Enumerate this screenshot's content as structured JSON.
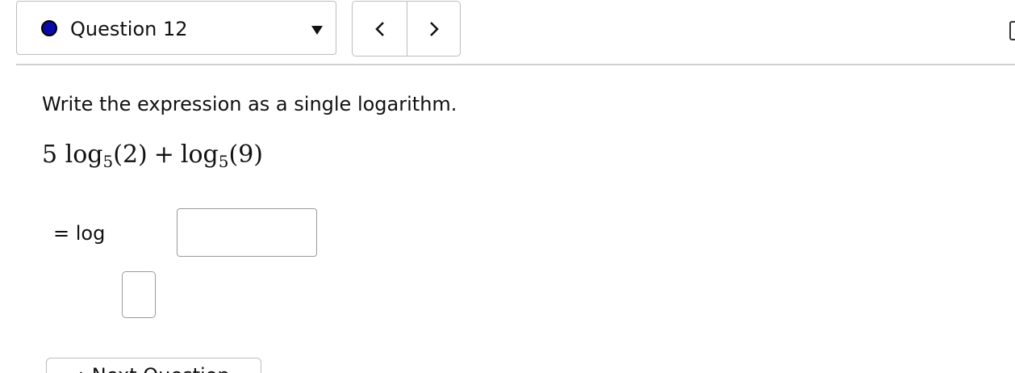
{
  "header": {
    "question_label": "Question 12",
    "status_dot_color": "#0a0aa8",
    "dropdown_icon": "triangle-down-icon",
    "prev_icon": "chevron-left-icon",
    "next_icon": "chevron-right-icon"
  },
  "problem": {
    "instruction": "Write the expression as a single logarithm.",
    "expression": {
      "coef": "5",
      "log1": "log",
      "base1": "5",
      "arg1": "(2)",
      "op": "+",
      "log2": "log",
      "base2": "5",
      "arg2": "(9)"
    }
  },
  "answer": {
    "label": "= log",
    "argument_value": "",
    "base_value": ""
  },
  "footer": {
    "next_question_label": "→ Next Question"
  }
}
